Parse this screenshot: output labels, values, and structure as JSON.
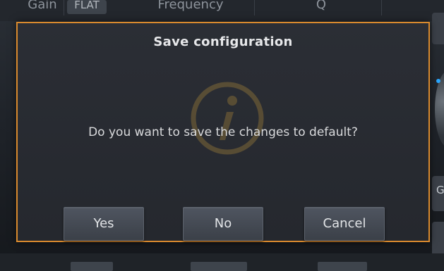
{
  "background": {
    "header_cells": [
      "Gain",
      "Frequency",
      "Q"
    ],
    "gain_chip": "FLAT",
    "right_labels": [
      "G"
    ]
  },
  "dialog": {
    "title": "Save configuration",
    "message": "Do you want to save the changes to default?",
    "buttons": {
      "yes": "Yes",
      "no": "No",
      "cancel": "Cancel"
    },
    "watermark_icon": "info-icon"
  },
  "colors": {
    "dialog_border": "#d98a2e",
    "dialog_bg": "#2b2e35",
    "button_bg": "#4f5560",
    "accent_dot": "#2aa7ff"
  }
}
